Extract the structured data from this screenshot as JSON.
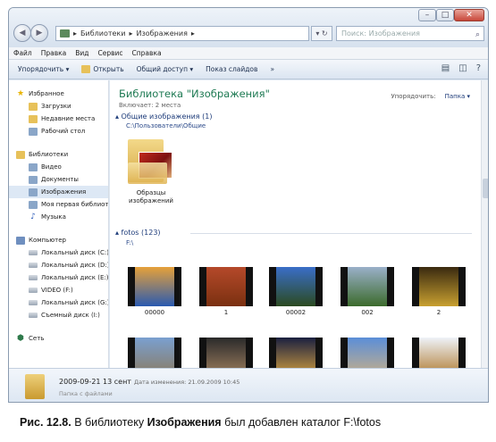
{
  "window": {
    "controls": {
      "minimize": "–",
      "maximize": "□",
      "close": "✕"
    },
    "nav": {
      "back": "◀",
      "forward": "▶"
    },
    "breadcrumb": [
      "Библиотеки",
      "Изображения"
    ],
    "address_controls": "▾ ↻",
    "search_placeholder": "Поиск: Изображения"
  },
  "menubar": [
    "Файл",
    "Правка",
    "Вид",
    "Сервис",
    "Справка"
  ],
  "toolbar": {
    "items": [
      "Упорядочить ▾",
      "Открыть",
      "Общий доступ ▾",
      "Показ слайдов",
      "»"
    ]
  },
  "navpane": {
    "favorites": {
      "label": "Избранное",
      "items": [
        "Загрузки",
        "Недавние места",
        "Рабочий стол"
      ]
    },
    "libraries": {
      "label": "Библиотеки",
      "items": [
        "Видео",
        "Документы",
        "Изображения",
        "Моя первая библиотека",
        "Музыка"
      ]
    },
    "computer": {
      "label": "Компьютер",
      "items": [
        "Локальный диск (C:)",
        "Локальный диск (D:)",
        "Локальный диск (E:)",
        "VIDEO (F:)",
        "Локальный диск (G:)",
        "Съемный диск (I:)"
      ]
    },
    "network": {
      "label": "Сеть"
    }
  },
  "content": {
    "title": "Библиотека \"Изображения\"",
    "subtitle": "Включает: 2 места",
    "arrange_label": "Упорядочить:",
    "arrange_value": "Папка ▾",
    "sections": [
      {
        "header": "▴ Общие изображения (1)",
        "path": "C:\\Пользователи\\Общие"
      },
      {
        "header": "▴ fotos (123)",
        "path": "F:\\"
      }
    ],
    "shared_folder": {
      "label": "Образцы изображений"
    },
    "thumbnails": [
      {
        "label": "00000",
        "colors": [
          "#e6a13a",
          "#2a5ab0"
        ]
      },
      {
        "label": "1",
        "colors": [
          "#b5492a",
          "#7a3010"
        ]
      },
      {
        "label": "00002",
        "colors": [
          "#3a6ec8",
          "#2b4a20"
        ]
      },
      {
        "label": "002",
        "colors": [
          "#9ab0c9",
          "#3c6b2c"
        ]
      },
      {
        "label": "2",
        "colors": [
          "#3a2a10",
          "#c8a030"
        ]
      },
      {
        "label": "",
        "colors": [
          "#7aa0d0",
          "#8a7a60"
        ]
      },
      {
        "label": "",
        "colors": [
          "#2a2a2a",
          "#a08060"
        ]
      },
      {
        "label": "",
        "colors": [
          "#1a2040",
          "#d4a040"
        ]
      },
      {
        "label": "",
        "colors": [
          "#5b8ed8",
          "#c8b088"
        ]
      },
      {
        "label": "",
        "colors": [
          "#eef2f8",
          "#b07a30"
        ]
      }
    ]
  },
  "details": {
    "name": "2009-09-21 13 сент",
    "meta": "Дата изменения: 21.09.2009 10:45",
    "type": "Папка с файлами"
  },
  "caption": {
    "prefix": "Рис. 12.8.",
    "text1": " В библиотеку ",
    "bold": "Изображения",
    "text2": " был добавлен каталог F:\\fotos"
  }
}
